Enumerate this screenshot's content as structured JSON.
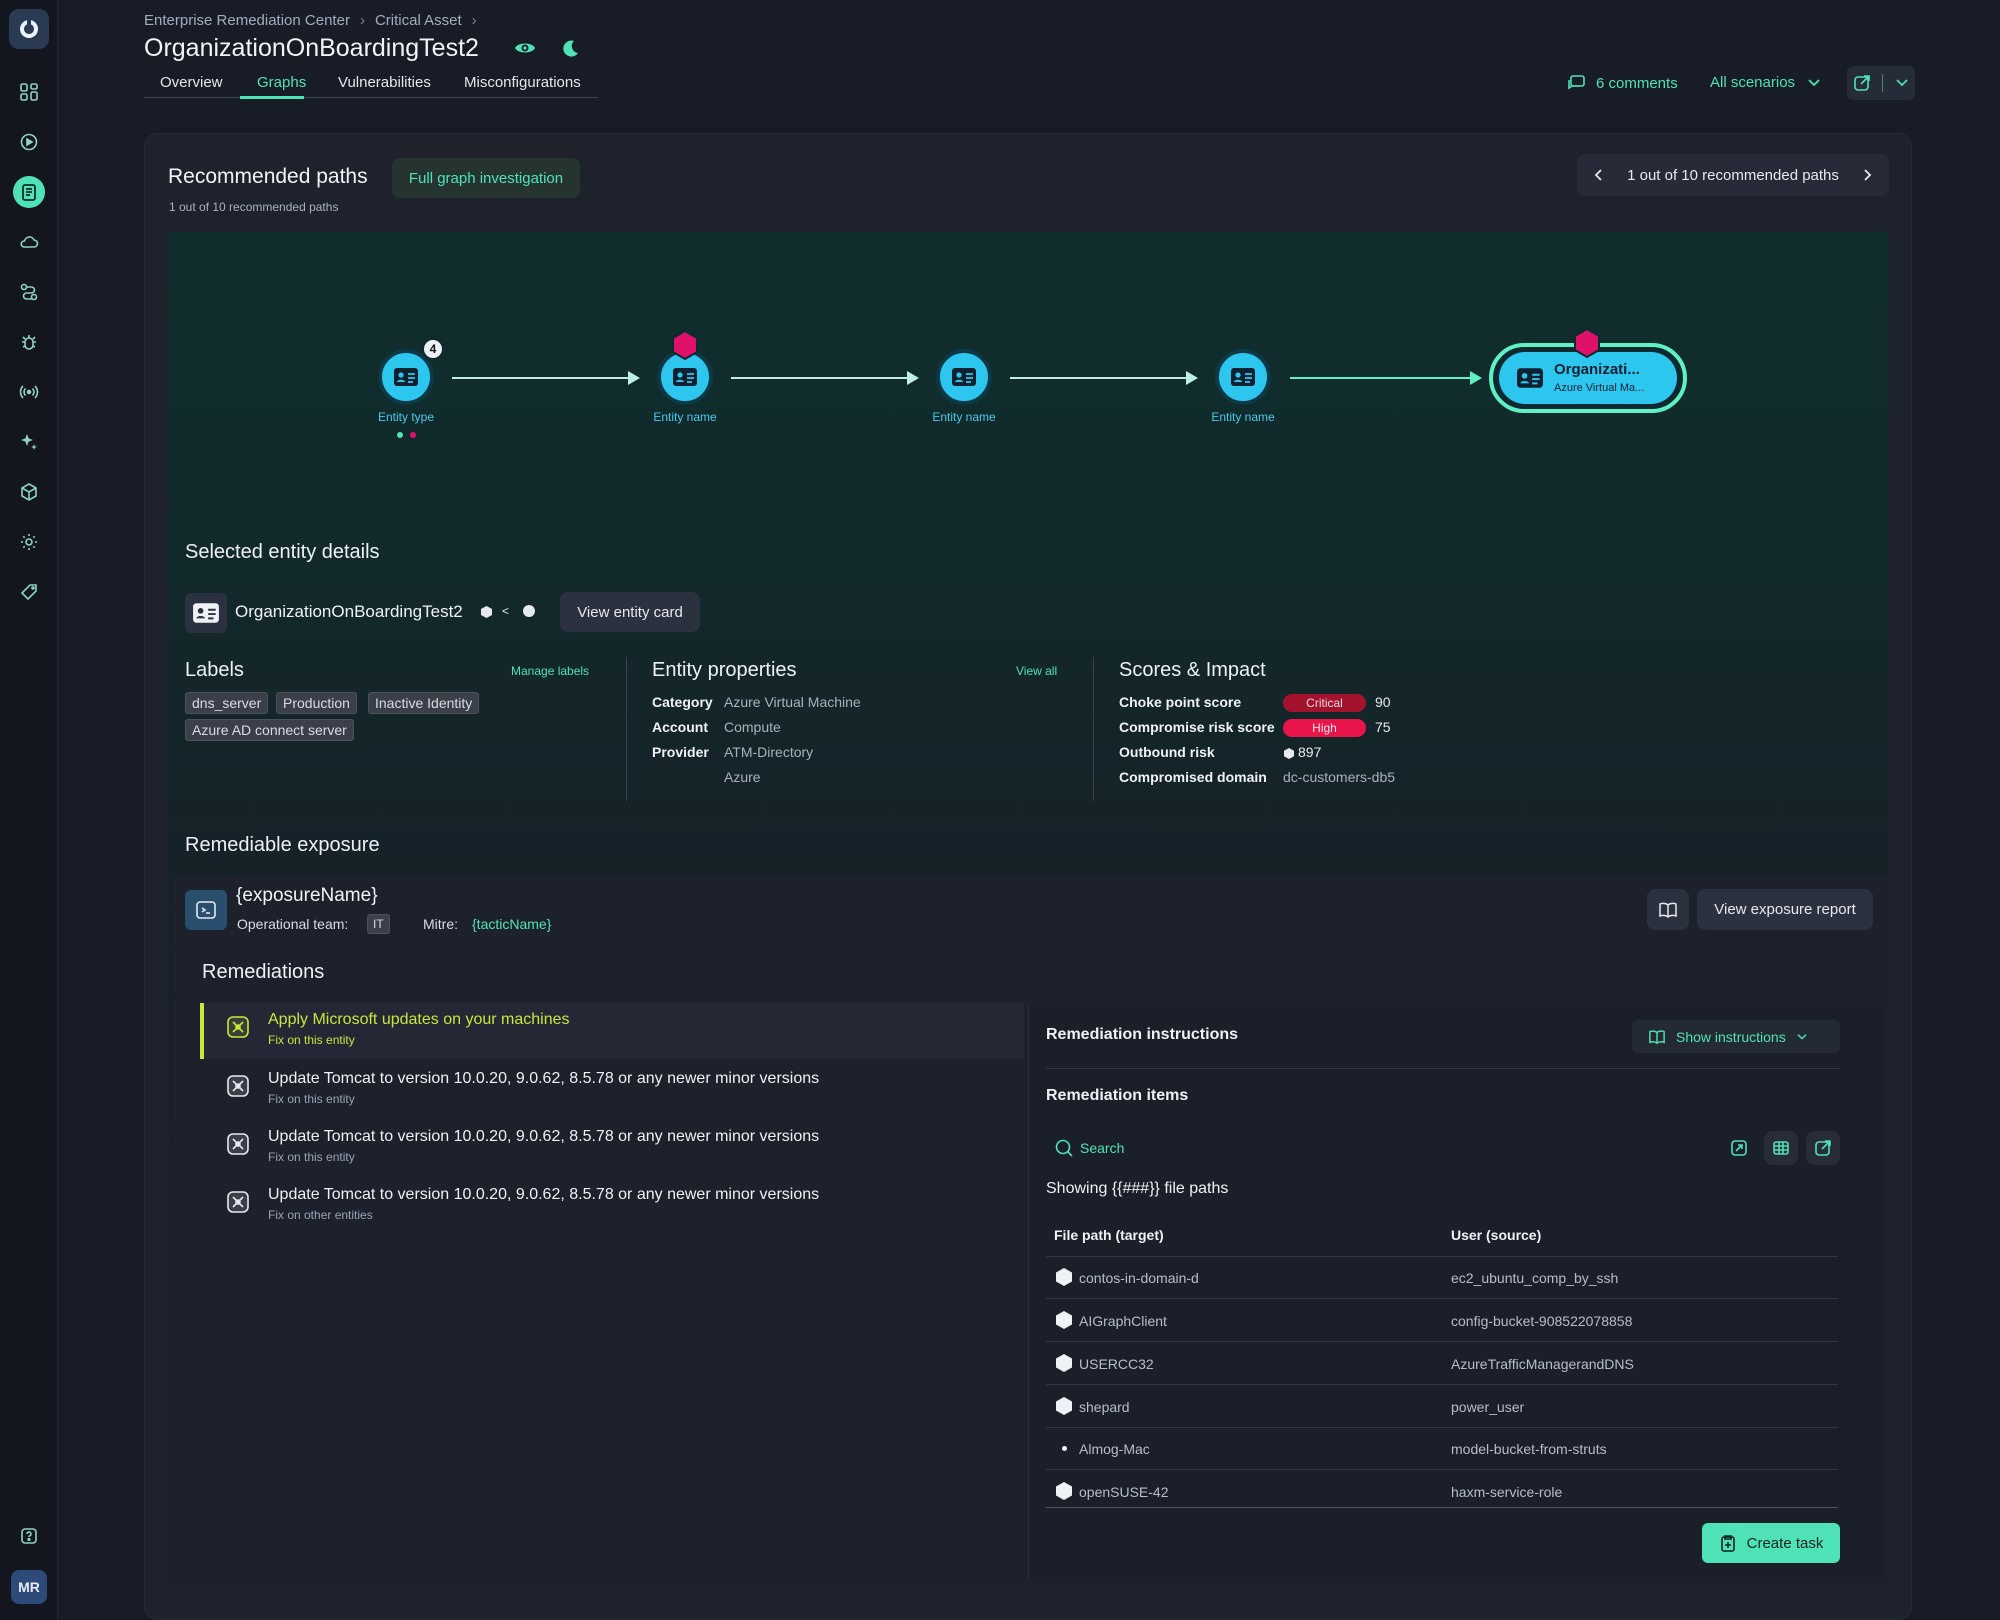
{
  "header": {
    "breadcrumb": [
      "Enterprise Remediation Center",
      "Critical Asset"
    ],
    "title": "OrganizationOnBoardingTest2",
    "tabs": [
      "Overview",
      "Graphs",
      "Vulnerabilities",
      "Misconfigurations"
    ],
    "active_tab": "Graphs",
    "comments": "6 comments",
    "scenario": "All scenarios"
  },
  "sidebar": {
    "icons": [
      "dashboard-icon",
      "radar-icon",
      "reports-icon",
      "cloud-icon",
      "routes-icon",
      "bug-icon",
      "signal-icon",
      "sparkle-icon",
      "cube-icon",
      "settings-icon",
      "tag-icon"
    ],
    "active": "reports-icon",
    "help": "help-icon",
    "avatar": "MR"
  },
  "recommended": {
    "title": "Recommended paths",
    "subtitle": "1 out of 10 recommended paths",
    "full_graph_button": "Full graph investigation",
    "pager": "1 out of 10 recommended paths"
  },
  "graph": {
    "nodes": [
      {
        "label": "Entity type",
        "badge": "4"
      },
      {
        "label": "Entity name"
      },
      {
        "label": "Entity name"
      },
      {
        "label": "Entity name"
      }
    ],
    "target": {
      "title": "Organizati...",
      "subtitle": "Azure Virtual Ma..."
    }
  },
  "selected": {
    "title": "Selected entity details",
    "entity_name": "OrganizationOnBoardingTest2",
    "view_card_button": "View entity card"
  },
  "labels": {
    "title": "Labels",
    "manage": "Manage labels",
    "items": [
      "dns_server",
      "Production",
      "Inactive Identity",
      "Azure AD connect server"
    ]
  },
  "properties": {
    "title": "Entity properties",
    "view_all": "View all",
    "rows": [
      {
        "key": "Category",
        "value": "Azure Virtual Machine"
      },
      {
        "key": "Account",
        "value": "Compute"
      },
      {
        "key": "Provider",
        "value": "ATM-Directory"
      },
      {
        "key": "",
        "value": "Azure"
      }
    ]
  },
  "scores": {
    "title": "Scores & Impact",
    "choke_label": "Choke point score",
    "choke_level": "Critical",
    "choke_value": "90",
    "risk_label": "Compromise risk score",
    "risk_level": "High",
    "risk_value": "75",
    "outbound_label": "Outbound risk",
    "outbound_value": "897",
    "domain_label": "Compromised domain",
    "domain_value": "dc-customers-db5",
    "colors": {
      "critical": "#a3132d",
      "high": "#e8144a"
    }
  },
  "exposure": {
    "section_title": "Remediable exposure",
    "name": "{exposureName}",
    "team_label": "Operational team:",
    "team_value": "IT",
    "mitre_label": "Mitre:",
    "mitre_value": "{tacticName}",
    "report_button": "View exposure report"
  },
  "remediations": {
    "title": "Remediations",
    "items": [
      {
        "title": "Apply Microsoft updates on your machines",
        "sub": "Fix on this entity"
      },
      {
        "title": "Update Tomcat to version 10.0.20, 9.0.62, 8.5.78 or any newer minor versions",
        "sub": "Fix on this entity"
      },
      {
        "title": "Update Tomcat to version 10.0.20, 9.0.62, 8.5.78 or any newer minor versions",
        "sub": "Fix on this entity"
      },
      {
        "title": "Update Tomcat to version 10.0.20, 9.0.62, 8.5.78 or any newer minor versions",
        "sub": "Fix on other entities"
      }
    ]
  },
  "panel": {
    "instructions_title": "Remediation instructions",
    "show_instructions": "Show instructions",
    "items_title": "Remediation items",
    "search_placeholder": "Search",
    "showing": "Showing {{###}} file paths",
    "col_target": "File path (target)",
    "col_source": "User (source)",
    "rows": [
      {
        "path": "contos-in-domain-d",
        "user": "ec2_ubuntu_comp_by_ssh"
      },
      {
        "path": "AIGraphClient",
        "user": "config-bucket-908522078858"
      },
      {
        "path": "USERCC32",
        "user": "AzureTrafficManagerandDNS"
      },
      {
        "path": "shepard",
        "user": "power_user"
      },
      {
        "path": "Almog-Mac",
        "user": "model-bucket-from-struts"
      },
      {
        "path": "openSUSE-42",
        "user": "haxm-service-role"
      }
    ],
    "create_task": "Create task"
  },
  "colors": {
    "accent": "#4fe2b8",
    "node": "#2dc6ef",
    "badge": "#e0116a",
    "highlight": "#c9e63a"
  }
}
